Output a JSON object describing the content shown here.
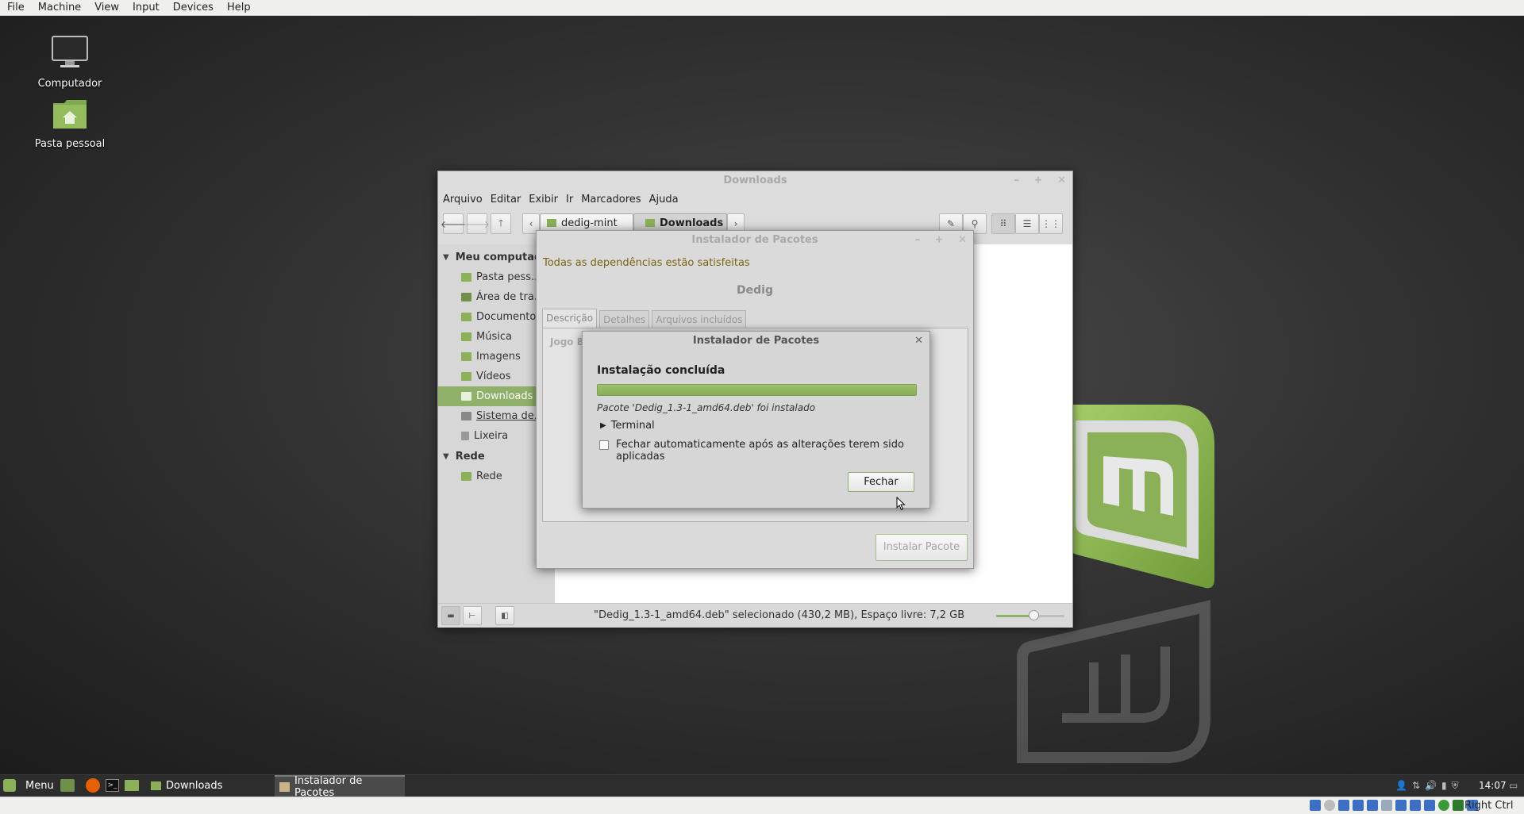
{
  "vbox": {
    "menu": [
      "File",
      "Machine",
      "View",
      "Input",
      "Devices",
      "Help"
    ],
    "host_key": "Right Ctrl"
  },
  "desktop": {
    "icons": [
      {
        "label": "Computador",
        "icon": "computer-icon"
      },
      {
        "label": "Pasta pessoal",
        "icon": "home-folder-icon"
      }
    ]
  },
  "nemo": {
    "title": "Downloads",
    "menu": [
      "Arquivo",
      "Editar",
      "Exibir",
      "Ir",
      "Marcadores",
      "Ajuda"
    ],
    "path": [
      "dedig-mint",
      "Downloads"
    ],
    "sidebar": {
      "sections": [
        {
          "title": "Meu computador",
          "items": [
            "Pasta pess...",
            "Área de tra...",
            "Documentos",
            "Música",
            "Imagens",
            "Vídeos",
            "Downloads",
            "Sistema de...",
            "Lixeira"
          ]
        },
        {
          "title": "Rede",
          "items": [
            "Rede"
          ]
        }
      ],
      "selected": "Downloads"
    },
    "status_text": "\"Dedig_1.3-1_amd64.deb\" selecionado (430,2 MB), Espaço livre: 7,2 GB",
    "zoom_level": 0.55
  },
  "gdebi": {
    "title": "Instalador de Pacotes",
    "status": "Todas as dependências estão satisfeitas",
    "package_name": "Dedig",
    "tabs": [
      "Descrição",
      "Detalhes",
      "Arquivos incluídos"
    ],
    "description_partial": "Jogo Ba",
    "install_button": "Instalar Pacote"
  },
  "dialog": {
    "title": "Instalador de Pacotes",
    "heading": "Instalação concluída",
    "progress": 1.0,
    "message": "Pacote 'Dedig_1.3-1_amd64.deb' foi instalado",
    "terminal_label": "Terminal",
    "auto_close_label": "Fechar automaticamente após as alterações terem sido aplicadas",
    "auto_close_checked": false,
    "close_button": "Fechar"
  },
  "taskbar": {
    "menu_label": "Menu",
    "windows": [
      "Downloads",
      "Instalador de Pacotes"
    ],
    "clock": "14:07"
  },
  "colors": {
    "mint_green": "#8bb158",
    "selection": "#8fb169",
    "status_text": "#7a6410"
  }
}
